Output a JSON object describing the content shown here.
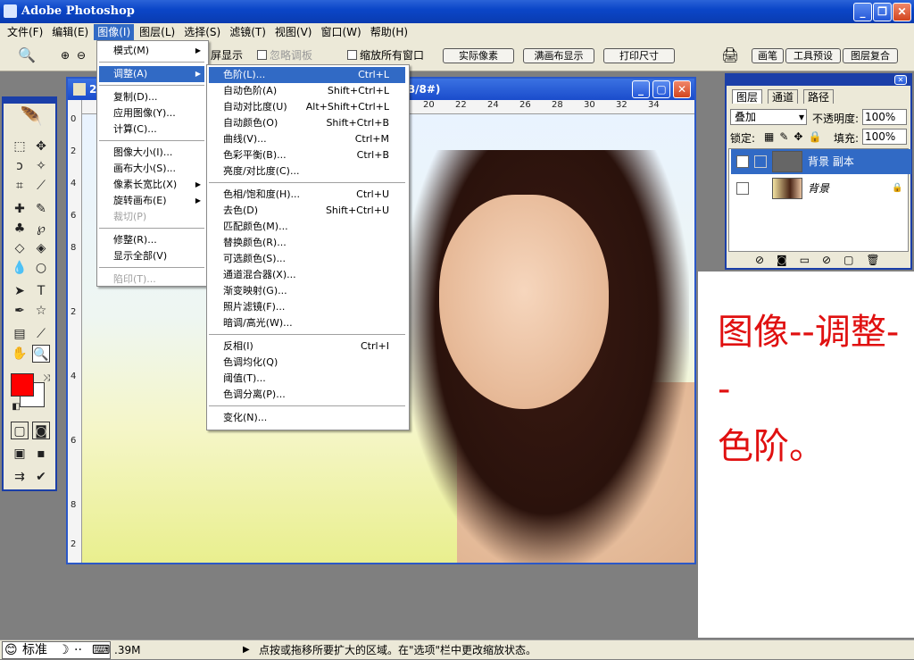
{
  "app": {
    "title": "Adobe Photoshop"
  },
  "menubar": [
    "文件(F)",
    "编辑(E)",
    "图像(I)",
    "图层(L)",
    "选择(S)",
    "滤镜(T)",
    "视图(V)",
    "窗口(W)",
    "帮助(H)"
  ],
  "options": {
    "btn_fit": "屏显示",
    "chk_ignore": "忽略调板",
    "chk_resize": "缩放所有窗口",
    "b_actual": "实际像素",
    "b_fill": "满画布显示",
    "b_print": "打印尺寸",
    "palette_tabs": [
      "画笔",
      "工具预设",
      "图层复合"
    ]
  },
  "document": {
    "title_fragment": "2",
    "title_end": "B/8#)",
    "ruler_top": [
      "20",
      "22",
      "24",
      "26",
      "28",
      "30",
      "32",
      "34"
    ],
    "ruler_left": [
      "0",
      "2",
      "4",
      "6",
      "8",
      "2",
      "4",
      "6",
      "8",
      "2"
    ]
  },
  "menu_image": {
    "items": [
      {
        "label": "模式(M)",
        "arrow": true
      },
      {
        "label": "调整(A)",
        "arrow": true,
        "selected": true
      },
      {
        "label": "复制(D)..."
      },
      {
        "label": "应用图像(Y)..."
      },
      {
        "label": "计算(C)..."
      },
      {
        "label": "图像大小(I)..."
      },
      {
        "label": "画布大小(S)..."
      },
      {
        "label": "像素长宽比(X)",
        "arrow": true
      },
      {
        "label": "旋转画布(E)",
        "arrow": true
      },
      {
        "label": "裁切(P)",
        "disabled": true
      },
      {
        "label": "修整(R)..."
      },
      {
        "label": "显示全部(V)"
      },
      {
        "label": "陷印(T)...",
        "disabled": true
      }
    ]
  },
  "menu_adjust": {
    "items": [
      {
        "label": "色阶(L)...",
        "shortcut": "Ctrl+L",
        "selected": true
      },
      {
        "label": "自动色阶(A)",
        "shortcut": "Shift+Ctrl+L"
      },
      {
        "label": "自动对比度(U)",
        "shortcut": "Alt+Shift+Ctrl+L"
      },
      {
        "label": "自动颜色(O)",
        "shortcut": "Shift+Ctrl+B"
      },
      {
        "label": "曲线(V)...",
        "shortcut": "Ctrl+M"
      },
      {
        "label": "色彩平衡(B)...",
        "shortcut": "Ctrl+B"
      },
      {
        "label": "亮度/对比度(C)..."
      },
      {
        "label": "色相/饱和度(H)...",
        "shortcut": "Ctrl+U"
      },
      {
        "label": "去色(D)",
        "shortcut": "Shift+Ctrl+U"
      },
      {
        "label": "匹配颜色(M)..."
      },
      {
        "label": "替换颜色(R)..."
      },
      {
        "label": "可选颜色(S)..."
      },
      {
        "label": "通道混合器(X)..."
      },
      {
        "label": "渐变映射(G)..."
      },
      {
        "label": "照片滤镜(F)..."
      },
      {
        "label": "暗调/高光(W)..."
      },
      {
        "label": "反相(I)",
        "shortcut": "Ctrl+I"
      },
      {
        "label": "色调均化(Q)"
      },
      {
        "label": "阈值(T)..."
      },
      {
        "label": "色调分离(P)..."
      },
      {
        "label": "变化(N)..."
      }
    ]
  },
  "layers": {
    "tabs": [
      "图层",
      "通道",
      "路径"
    ],
    "blend": "叠加",
    "opacity_label": "不透明度:",
    "opacity": "100%",
    "lock_label": "锁定:",
    "fill_label": "填充:",
    "fill": "100%",
    "rows": [
      {
        "name": "背景 副本"
      },
      {
        "name": "背景"
      }
    ]
  },
  "annotation": "图像--调整--\n色阶。",
  "status": {
    "ime": "标准",
    "size": ".39M",
    "hint": "点按或拖移所要扩大的区域。在\"选项\"栏中更改缩放状态。"
  }
}
